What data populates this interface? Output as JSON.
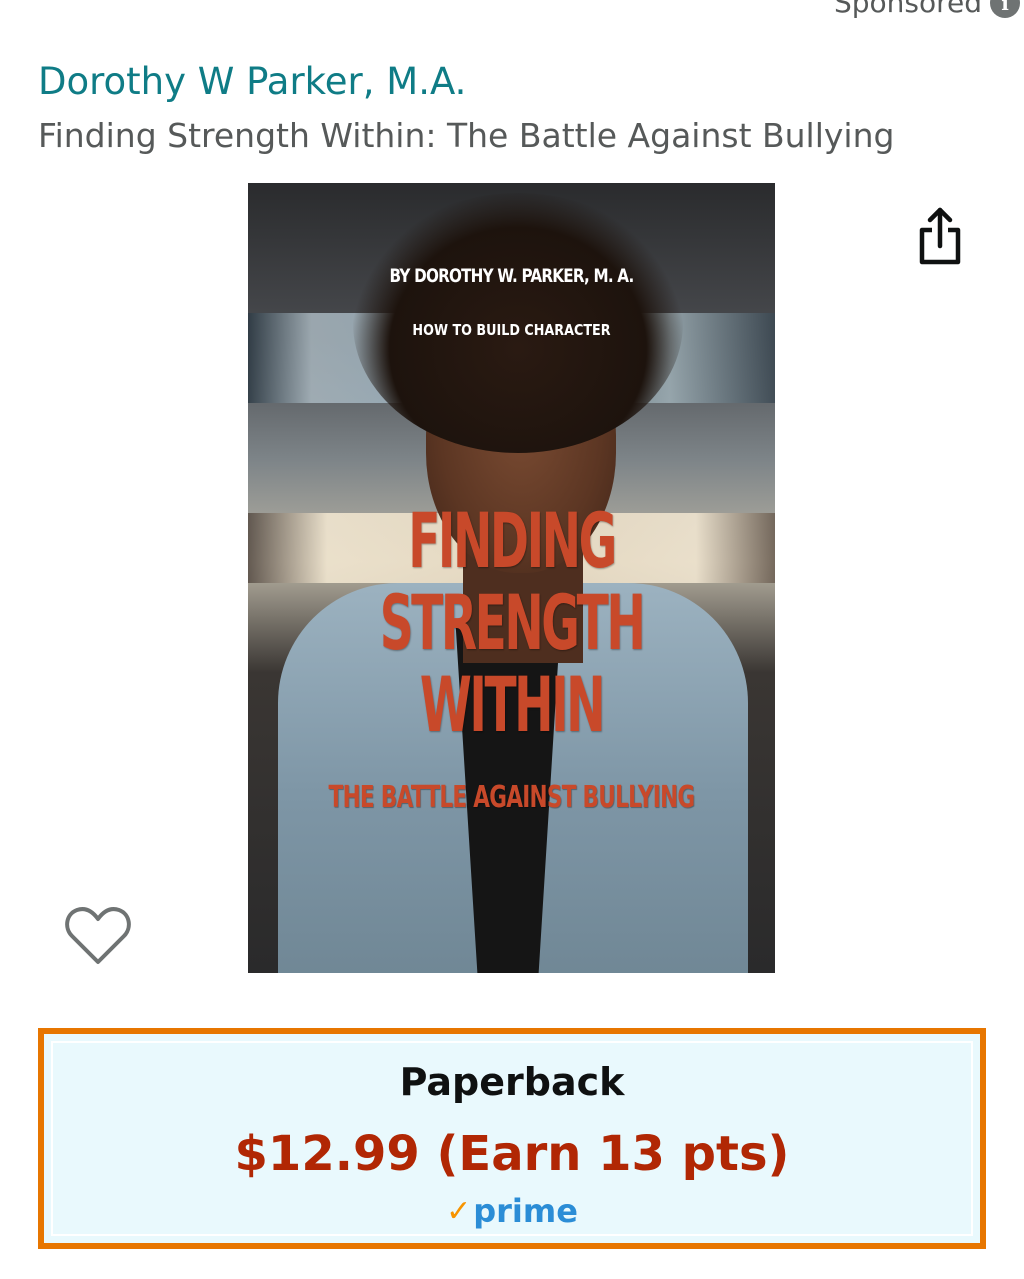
{
  "sponsored": {
    "label": "Sponsored",
    "info_icon": "i"
  },
  "product": {
    "author": "Dorothy W Parker, M.A.",
    "title": "Finding Strength Within: The Battle Against Bullying"
  },
  "icons": {
    "share": "share-icon",
    "wishlist": "heart-icon"
  },
  "cover": {
    "by_line": "BY DOROTHY W. PARKER, M. A.",
    "tagline": "HOW TO BUILD CHARACTER",
    "title_line1": "FINDING",
    "title_line2": "STRENGTH",
    "title_line3": "WITHIN",
    "subtitle": "THE BATTLE AGAINST BULLYING"
  },
  "format": {
    "label": "Paperback",
    "price": "$12.99 (Earn 13 pts)",
    "prime_check": "✓",
    "prime_label": "prime"
  },
  "colors": {
    "author_link": "#0f7c86",
    "price": "#b12704",
    "selected_border": "#e77600",
    "selected_bg": "#e9f9fd",
    "prime_blue": "#2b8dd6",
    "prime_check": "#f79400"
  }
}
